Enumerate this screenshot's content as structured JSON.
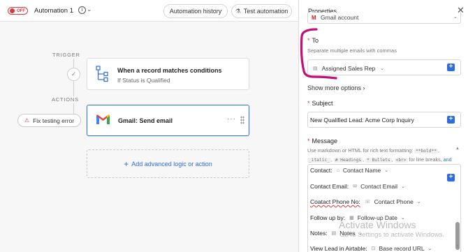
{
  "topbar": {
    "toggle_label": "OFF",
    "automation_name": "Automation 1",
    "history_button": "Automation history",
    "test_button": "Test automation"
  },
  "canvas": {
    "trigger_label": "TRIGGER",
    "actions_label": "ACTIONS",
    "trigger_card": {
      "title": "When a record matches conditions",
      "subtitle": "If Status is Qualified"
    },
    "action_card": {
      "title": "Gmail: Send email",
      "menu": "···"
    },
    "fix_button": "Fix testing error",
    "add_logic": "Add advanced logic or action"
  },
  "panel": {
    "title": "Properties",
    "gmail_account": "Gmail account",
    "to": {
      "label": "To",
      "hint": "Separate multiple emails with commas",
      "chip": "Assigned Sales Rep"
    },
    "show_more": "Show more options",
    "subject": {
      "label": "Subject",
      "value": "New Qualified Lead: Acme Corp Inquiry"
    },
    "message": {
      "label": "Message",
      "hint_prefix": "Use markdown or HTML for rich text formatting:",
      "hint_codes": [
        "**bold**",
        "_italic_",
        "# Headings",
        "* Bullets",
        "<br>"
      ],
      "hint_suffix": "for line breaks,",
      "hint_more": "and more",
      "lines": [
        {
          "label": "Contact:",
          "token": "Contact Name"
        },
        {
          "label": "Contact Email:",
          "token": "Contact Email"
        },
        {
          "label": "Coatact Phone No:",
          "token": "Contact Phone"
        },
        {
          "label": "Follow up by:",
          "token": "Follow-up Date"
        },
        {
          "label": "Notes:",
          "token": "Notes"
        },
        {
          "label": "View Lead in Airtable:",
          "token": "Base record URL"
        }
      ]
    }
  },
  "watermark": {
    "title": "Activate Windows",
    "subtitle": "Go to Settings to activate Windows."
  },
  "colors": {
    "accent": "#2d6cdf",
    "danger": "#d9363e",
    "annotation": "#c0107a"
  }
}
